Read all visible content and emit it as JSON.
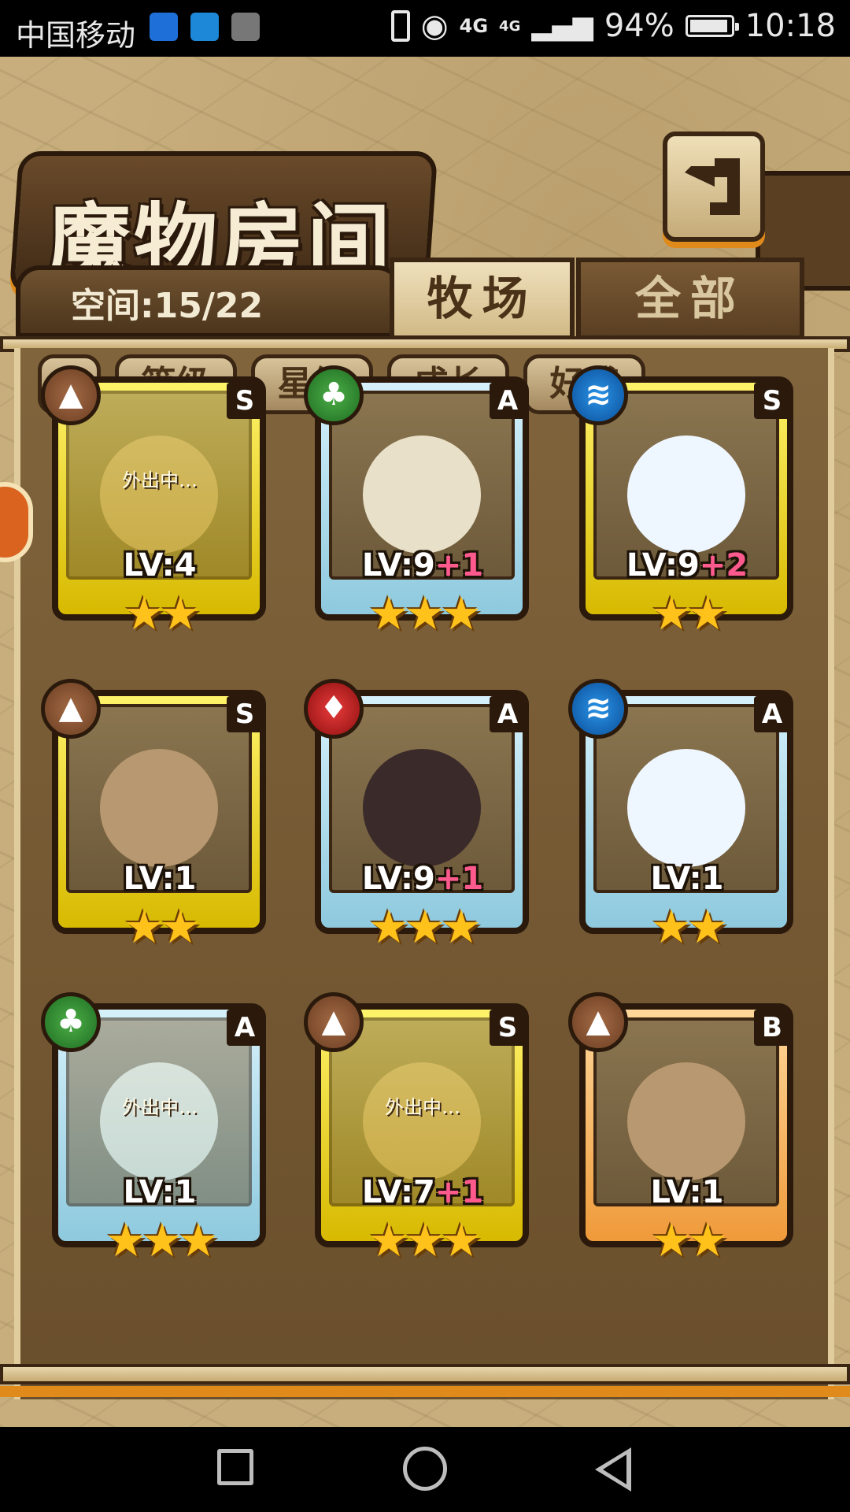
{
  "statusbar": {
    "carrier": "中国移动",
    "network": "4G",
    "network2": "4G",
    "battery": "94%",
    "battery_level": 0.94,
    "time": "10:18"
  },
  "header": {
    "title": "魔物房间",
    "back_icon": "back-arrow-icon"
  },
  "panel": {
    "space_label": "空间:15/22",
    "tabs": [
      {
        "label": "牧场",
        "active": true
      },
      {
        "label": "全部",
        "active": false
      }
    ]
  },
  "filters": [
    {
      "label": "等级"
    },
    {
      "label": "星级"
    },
    {
      "label": "成长"
    },
    {
      "label": "好感"
    }
  ],
  "cards": [
    {
      "rank": "S",
      "element": "earth",
      "frame": "gold",
      "lv": "LV:4",
      "plus": "",
      "stars": "★★",
      "status": "外出中…",
      "away": true
    },
    {
      "rank": "A",
      "element": "wood",
      "frame": "blue",
      "lv": "LV:9",
      "plus": "+1",
      "stars": "★★★",
      "status": "",
      "away": false
    },
    {
      "rank": "S",
      "element": "water",
      "frame": "gold",
      "lv": "LV:9",
      "plus": "+2",
      "stars": "★★",
      "status": "",
      "away": false
    },
    {
      "rank": "S",
      "element": "earth",
      "frame": "gold",
      "lv": "LV:1",
      "plus": "",
      "stars": "★★",
      "status": "",
      "away": false
    },
    {
      "rank": "A",
      "element": "fire",
      "frame": "blue",
      "lv": "LV:9",
      "plus": "+1",
      "stars": "★★★",
      "status": "",
      "away": false
    },
    {
      "rank": "A",
      "element": "water",
      "frame": "blue",
      "lv": "LV:1",
      "plus": "",
      "stars": "★★",
      "status": "",
      "away": false
    },
    {
      "rank": "A",
      "element": "wood",
      "frame": "blue",
      "lv": "LV:1",
      "plus": "",
      "stars": "★★★",
      "status": "外出中…",
      "away": true
    },
    {
      "rank": "S",
      "element": "earth",
      "frame": "gold",
      "lv": "LV:7",
      "plus": "+1",
      "stars": "★★★",
      "status": "外出中…",
      "away": true
    },
    {
      "rank": "B",
      "element": "earth",
      "frame": "orange",
      "lv": "LV:1",
      "plus": "",
      "stars": "★★",
      "status": "",
      "away": false
    }
  ],
  "navbar": {
    "icons": [
      "recent-apps-icon",
      "home-icon",
      "back-icon"
    ]
  }
}
